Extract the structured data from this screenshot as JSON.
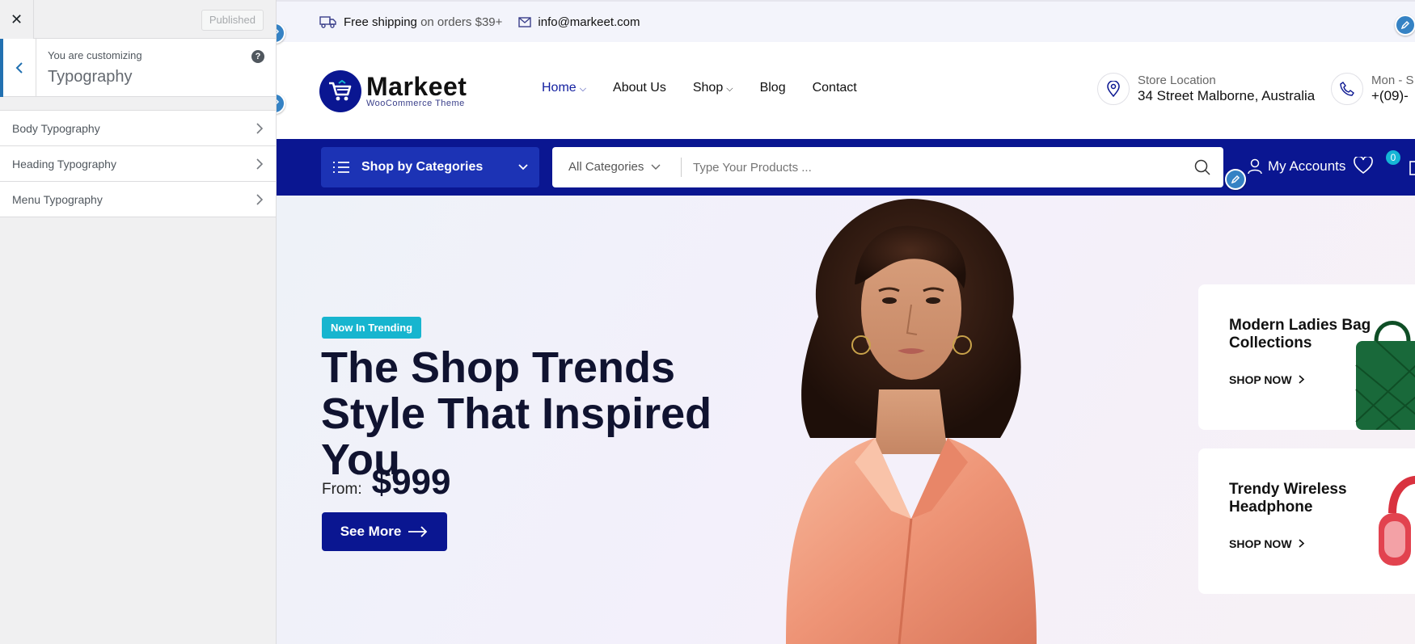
{
  "customizer": {
    "close_label": "✕",
    "publish_label": "Published",
    "customizing_label": "You are customizing",
    "section_title": "Typography",
    "help_label": "?",
    "items": [
      {
        "label": "Body Typography"
      },
      {
        "label": "Heading Typography"
      },
      {
        "label": "Menu Typography"
      }
    ]
  },
  "topbar": {
    "shipping_bold": "Free shipping",
    "shipping_rest": "on orders $39+",
    "email": "info@markeet.com"
  },
  "header": {
    "brand": "Markeet",
    "brand_sub": "WooCommerce Theme",
    "nav": [
      {
        "label": "Home"
      },
      {
        "label": "About Us"
      },
      {
        "label": "Shop"
      },
      {
        "label": "Blog"
      },
      {
        "label": "Contact"
      }
    ],
    "store_label": "Store Location",
    "store_value": "34 Street Malborne, Australia",
    "hours_label": "Mon - S",
    "hours_value": "+(09)-"
  },
  "navbar": {
    "categories_label": "Shop by Categories",
    "search_category": "All Categories",
    "search_placeholder": "Type Your Products ...",
    "accounts_label": "My Accounts",
    "wishlist_count": "0"
  },
  "hero": {
    "badge": "Now In Trending",
    "title": "The Shop Trends Style That Inspired You",
    "from_label": "From:",
    "price": "$999",
    "cta": "See More"
  },
  "promos": [
    {
      "title": "Modern Ladies Bag Collections",
      "link": "SHOP NOW"
    },
    {
      "title": "Trendy Wireless Headphone",
      "link": "SHOP NOW"
    }
  ],
  "colors": {
    "brand_navy": "#0a1691",
    "accent_cyan": "#17b5cf",
    "wp_blue": "#2271b1"
  }
}
